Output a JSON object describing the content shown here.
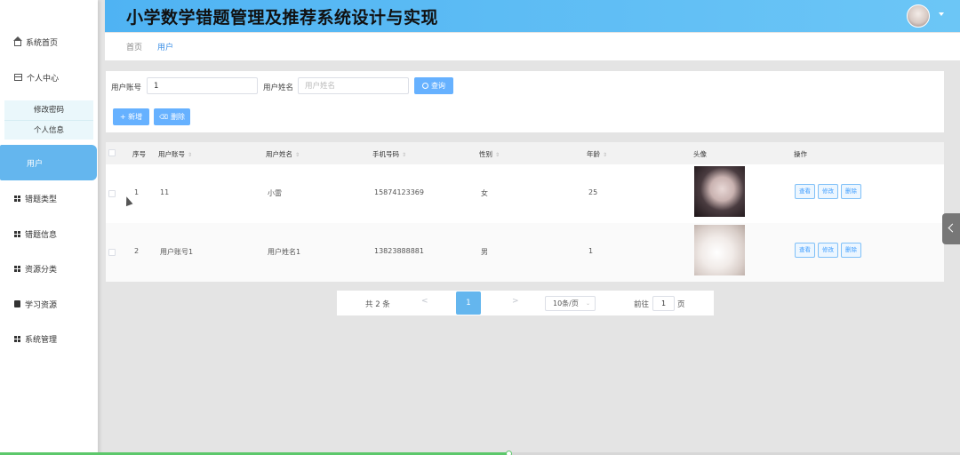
{
  "app": {
    "title": "小学数学错题管理及推荐系统设计与实现"
  },
  "sidebar": {
    "home": "系统首页",
    "personal_center": "个人中心",
    "submenu": [
      "修改密码",
      "个人信息"
    ],
    "users": "用户",
    "wrong_type": "错题类型",
    "wrong_info": "错题信息",
    "resource_category": "资源分类",
    "learning_resource": "学习资源",
    "system_management": "系统管理"
  },
  "breadcrumb": {
    "home": "首页",
    "current": "用户"
  },
  "search": {
    "account_label": "用户账号",
    "account_value": "1",
    "name_label": "用户姓名",
    "name_placeholder": "用户姓名",
    "query_button": "查询",
    "add_button": "+ 新增",
    "delete_button": "删除"
  },
  "table": {
    "headers": [
      "序号",
      "用户账号",
      "用户姓名",
      "手机号码",
      "性别",
      "年龄",
      "头像",
      "操作"
    ],
    "rows": [
      {
        "index": "1",
        "account": "11",
        "name": "小雷",
        "phone": "15874123369",
        "gender": "女",
        "age": "25"
      },
      {
        "index": "2",
        "account": "用户账号1",
        "name": "用户姓名1",
        "phone": "13823888881",
        "gender": "男",
        "age": "1"
      }
    ],
    "actions": {
      "view": "查看",
      "edit": "修改",
      "delete": "删除"
    }
  },
  "pagination": {
    "total": "共 2 条",
    "prev": "<",
    "current_page": "1",
    "next": ">",
    "page_size": "10条/页",
    "goto_label": "前往",
    "goto_value": "1",
    "goto_unit": "页"
  },
  "video_progress": 0.53,
  "colors": {
    "accent": "#64b6ee",
    "header_start": "#4fb3f3",
    "header_end": "#6cc6f6"
  }
}
